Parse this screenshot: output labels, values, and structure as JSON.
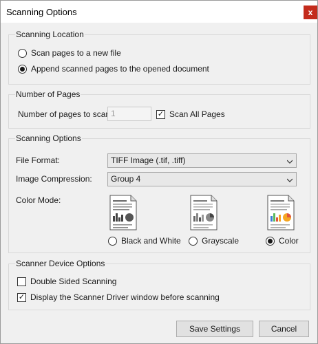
{
  "window": {
    "title": "Scanning Options",
    "close_glyph": "x"
  },
  "scanning_location": {
    "title": "Scanning Location",
    "options": [
      {
        "label": "Scan pages to a new file",
        "checked": false
      },
      {
        "label": "Append scanned pages to the opened document",
        "checked": true
      }
    ]
  },
  "number_of_pages": {
    "title": "Number of Pages",
    "pages_label": "Number of pages to scan:",
    "pages_value": "1",
    "scan_all_label": "Scan All Pages",
    "scan_all_checked": true
  },
  "scanning_options": {
    "title": "Scanning Options",
    "file_format_label": "File Format:",
    "file_format_value": "TIFF Image (.tif, .tiff)",
    "compression_label": "Image Compression:",
    "compression_value": "Group 4",
    "color_mode_label": "Color Mode:",
    "color_modes": [
      {
        "label": "Black and White",
        "checked": false,
        "icon": "bw-document-icon"
      },
      {
        "label": "Grayscale",
        "checked": false,
        "icon": "grayscale-document-icon"
      },
      {
        "label": "Color",
        "checked": true,
        "icon": "color-document-icon"
      }
    ]
  },
  "scanner_device": {
    "title": "Scanner Device Options",
    "options": [
      {
        "label": "Double Sided Scanning",
        "checked": false
      },
      {
        "label": "Display the Scanner Driver window before scanning",
        "checked": true
      }
    ]
  },
  "buttons": {
    "save": "Save Settings",
    "cancel": "Cancel"
  },
  "colors": {
    "close": "#c42b1c",
    "chart_orange": "#f5a623",
    "chart_blue": "#3a7bd5",
    "chart_green": "#5cb85c",
    "chart_red": "#e0533d"
  }
}
